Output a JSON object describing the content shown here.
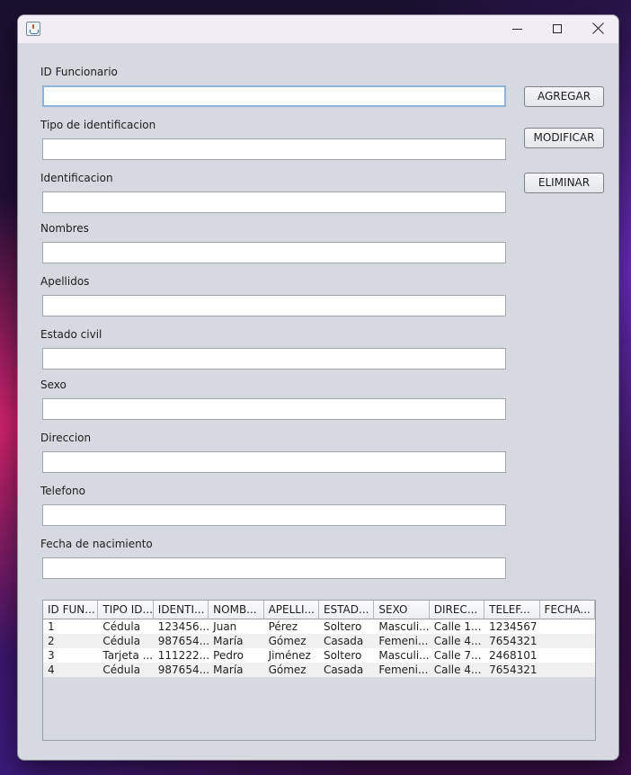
{
  "form": {
    "fields": [
      {
        "label": "ID Funcionario",
        "value": "",
        "focused": true
      },
      {
        "label": "Tipo de identificacion",
        "value": ""
      },
      {
        "label": "Identificacion",
        "value": ""
      },
      {
        "label": "Nombres",
        "value": ""
      },
      {
        "label": "Apellidos",
        "value": ""
      },
      {
        "label": "Estado civil",
        "value": ""
      },
      {
        "label": "Sexo",
        "value": ""
      },
      {
        "label": "Direccion",
        "value": ""
      },
      {
        "label": "Telefono",
        "value": ""
      },
      {
        "label": "Fecha de nacimiento",
        "value": ""
      }
    ]
  },
  "actions": {
    "add": "AGREGAR",
    "modify": "MODIFICAR",
    "delete": "ELIMINAR"
  },
  "table": {
    "columns": [
      "ID FUN...",
      "TIPO ID...",
      "IDENTI...",
      "NOMB...",
      "APELLI...",
      "ESTAD...",
      "SEXO",
      "DIREC...",
      "TELEF...",
      "FECHA..."
    ],
    "rows": [
      [
        "1",
        "Cédula",
        "123456...",
        "Juan",
        "Pérez",
        "Soltero",
        "Masculi...",
        "Calle 1...",
        "1234567",
        ""
      ],
      [
        "2",
        "Cédula",
        "987654...",
        "María",
        "Gómez",
        "Casada",
        "Femeni...",
        "Calle 4...",
        "7654321",
        ""
      ],
      [
        "3",
        "Tarjeta ...",
        "111222...",
        "Pedro",
        "Jiménez",
        "Soltero",
        "Masculi...",
        "Calle 7...",
        "2468101",
        ""
      ],
      [
        "4",
        "Cédula",
        "987654...",
        "María",
        "Gómez",
        "Casada",
        "Femeni...",
        "Calle 4...",
        "7654321",
        ""
      ]
    ]
  },
  "titlebar": {
    "icons": [
      "java-app-icon",
      "minimize-icon",
      "maximize-icon",
      "close-icon"
    ]
  }
}
